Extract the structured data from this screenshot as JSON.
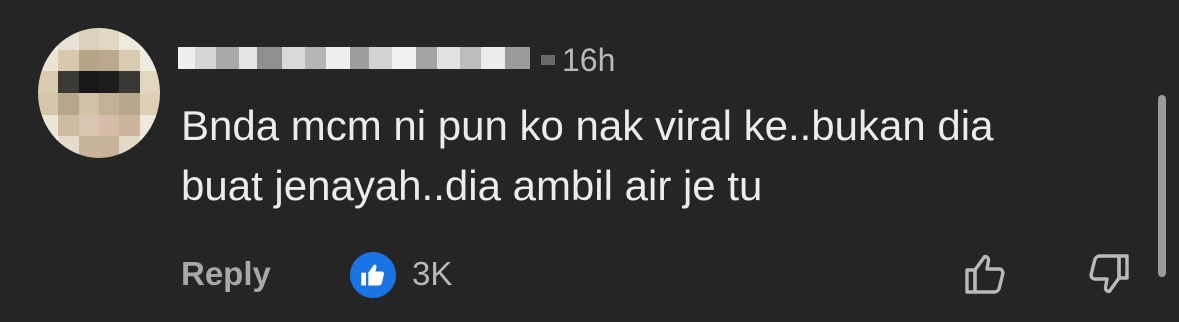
{
  "comment": {
    "author_name": "",
    "timestamp": "16h",
    "text": "Bnda mcm ni pun ko nak viral ke..bukan dia\nbuat jenayah..dia ambil air je tu",
    "reply_label": "Reply",
    "reaction_count": "3K",
    "reaction_icon": "thumbs-up-icon",
    "upvote_icon": "thumbs-up-outline-icon",
    "downvote_icon": "thumbs-down-outline-icon"
  },
  "colors": {
    "background": "#252526",
    "text": "#ececec",
    "muted": "#b9b9bb",
    "reaction_blue": "#1b74e4"
  }
}
